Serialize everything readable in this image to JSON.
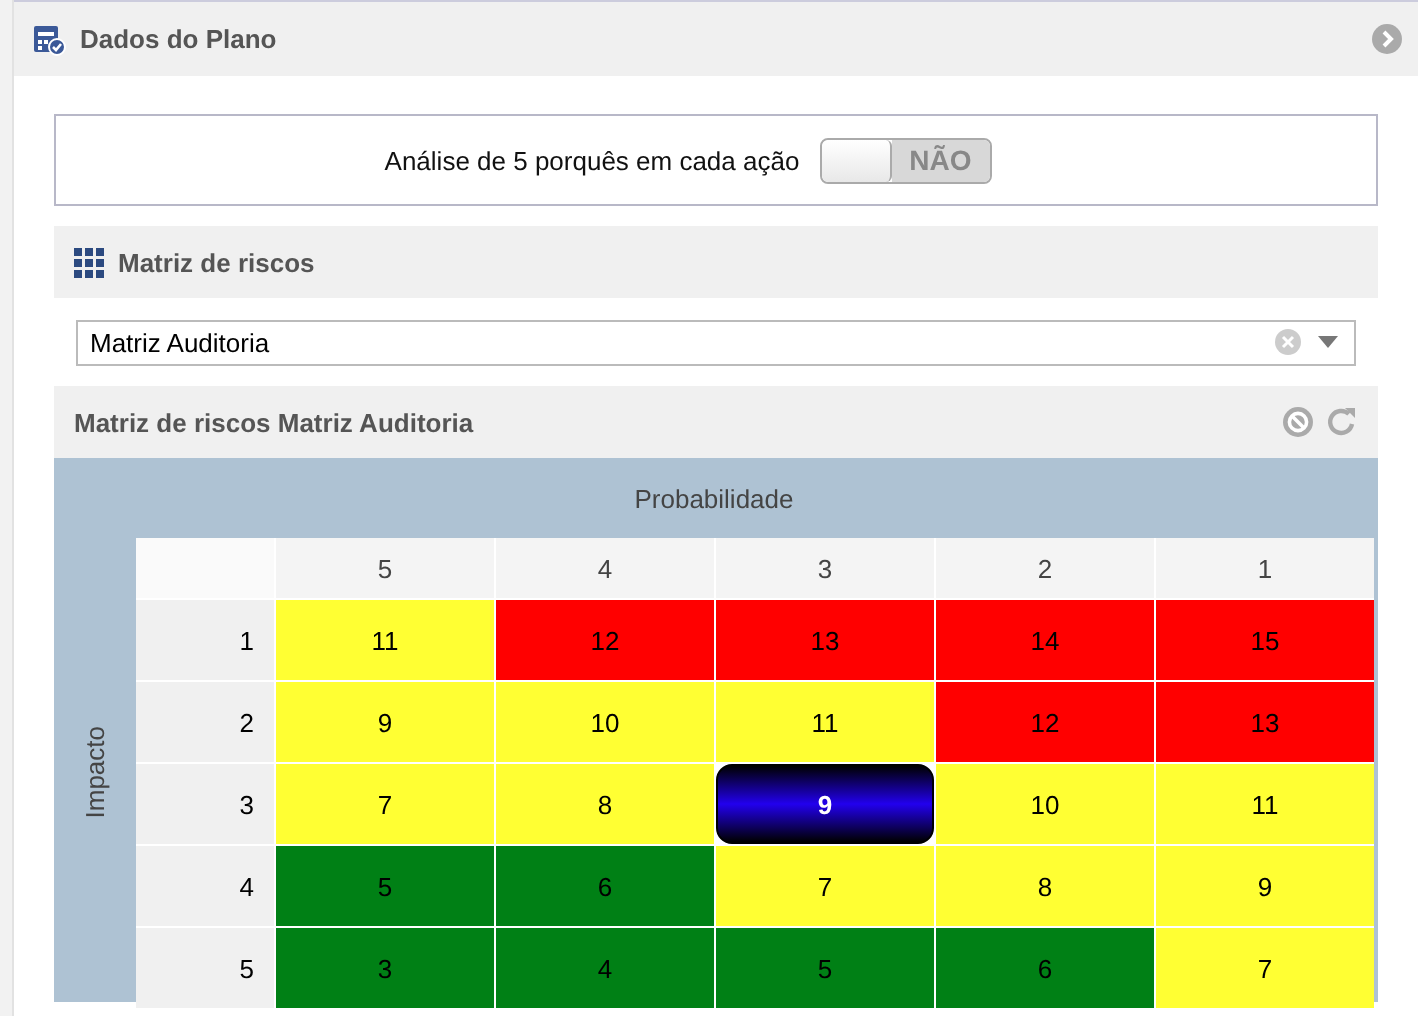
{
  "header": {
    "title": "Dados do Plano"
  },
  "five_whys": {
    "label": "Análise de 5 porquês em cada ação",
    "toggle": {
      "on": false,
      "label": "NÃO"
    }
  },
  "risk_matrix_panel": {
    "title": "Matriz de riscos",
    "select": {
      "value": "Matriz Auditoria"
    },
    "subtitle": "Matriz de riscos Matriz Auditoria",
    "matrix": {
      "x_axis": "Probabilidade",
      "y_axis": "Impacto",
      "columns": [
        "5",
        "4",
        "3",
        "2",
        "1"
      ],
      "rows": [
        {
          "label": "1",
          "cells": [
            {
              "text": "11",
              "color": "#ffff33",
              "selected": false
            },
            {
              "text": "12",
              "color": "#ff0000",
              "selected": false
            },
            {
              "text": "13",
              "color": "#ff0000",
              "selected": false
            },
            {
              "text": "14",
              "color": "#ff0000",
              "selected": false
            },
            {
              "text": "15",
              "color": "#ff0000",
              "selected": false
            }
          ]
        },
        {
          "label": "2",
          "cells": [
            {
              "text": "9",
              "color": "#ffff33",
              "selected": false
            },
            {
              "text": "10",
              "color": "#ffff33",
              "selected": false
            },
            {
              "text": "11",
              "color": "#ffff33",
              "selected": false
            },
            {
              "text": "12",
              "color": "#ff0000",
              "selected": false
            },
            {
              "text": "13",
              "color": "#ff0000",
              "selected": false
            }
          ]
        },
        {
          "label": "3",
          "cells": [
            {
              "text": "7",
              "color": "#ffff33",
              "selected": false
            },
            {
              "text": "8",
              "color": "#ffff33",
              "selected": false
            },
            {
              "text": "9",
              "color": "#2200ee",
              "selected": true
            },
            {
              "text": "10",
              "color": "#ffff33",
              "selected": false
            },
            {
              "text": "11",
              "color": "#ffff33",
              "selected": false
            }
          ]
        },
        {
          "label": "4",
          "cells": [
            {
              "text": "5",
              "color": "#008015",
              "selected": false
            },
            {
              "text": "6",
              "color": "#008015",
              "selected": false
            },
            {
              "text": "7",
              "color": "#ffff33",
              "selected": false
            },
            {
              "text": "8",
              "color": "#ffff33",
              "selected": false
            },
            {
              "text": "9",
              "color": "#ffff33",
              "selected": false
            }
          ]
        },
        {
          "label": "5",
          "cells": [
            {
              "text": "3",
              "color": "#008015",
              "selected": false
            },
            {
              "text": "4",
              "color": "#008015",
              "selected": false
            },
            {
              "text": "5",
              "color": "#008015",
              "selected": false
            },
            {
              "text": "6",
              "color": "#008015",
              "selected": false
            },
            {
              "text": "7",
              "color": "#ffff33",
              "selected": false
            }
          ]
        }
      ]
    }
  }
}
